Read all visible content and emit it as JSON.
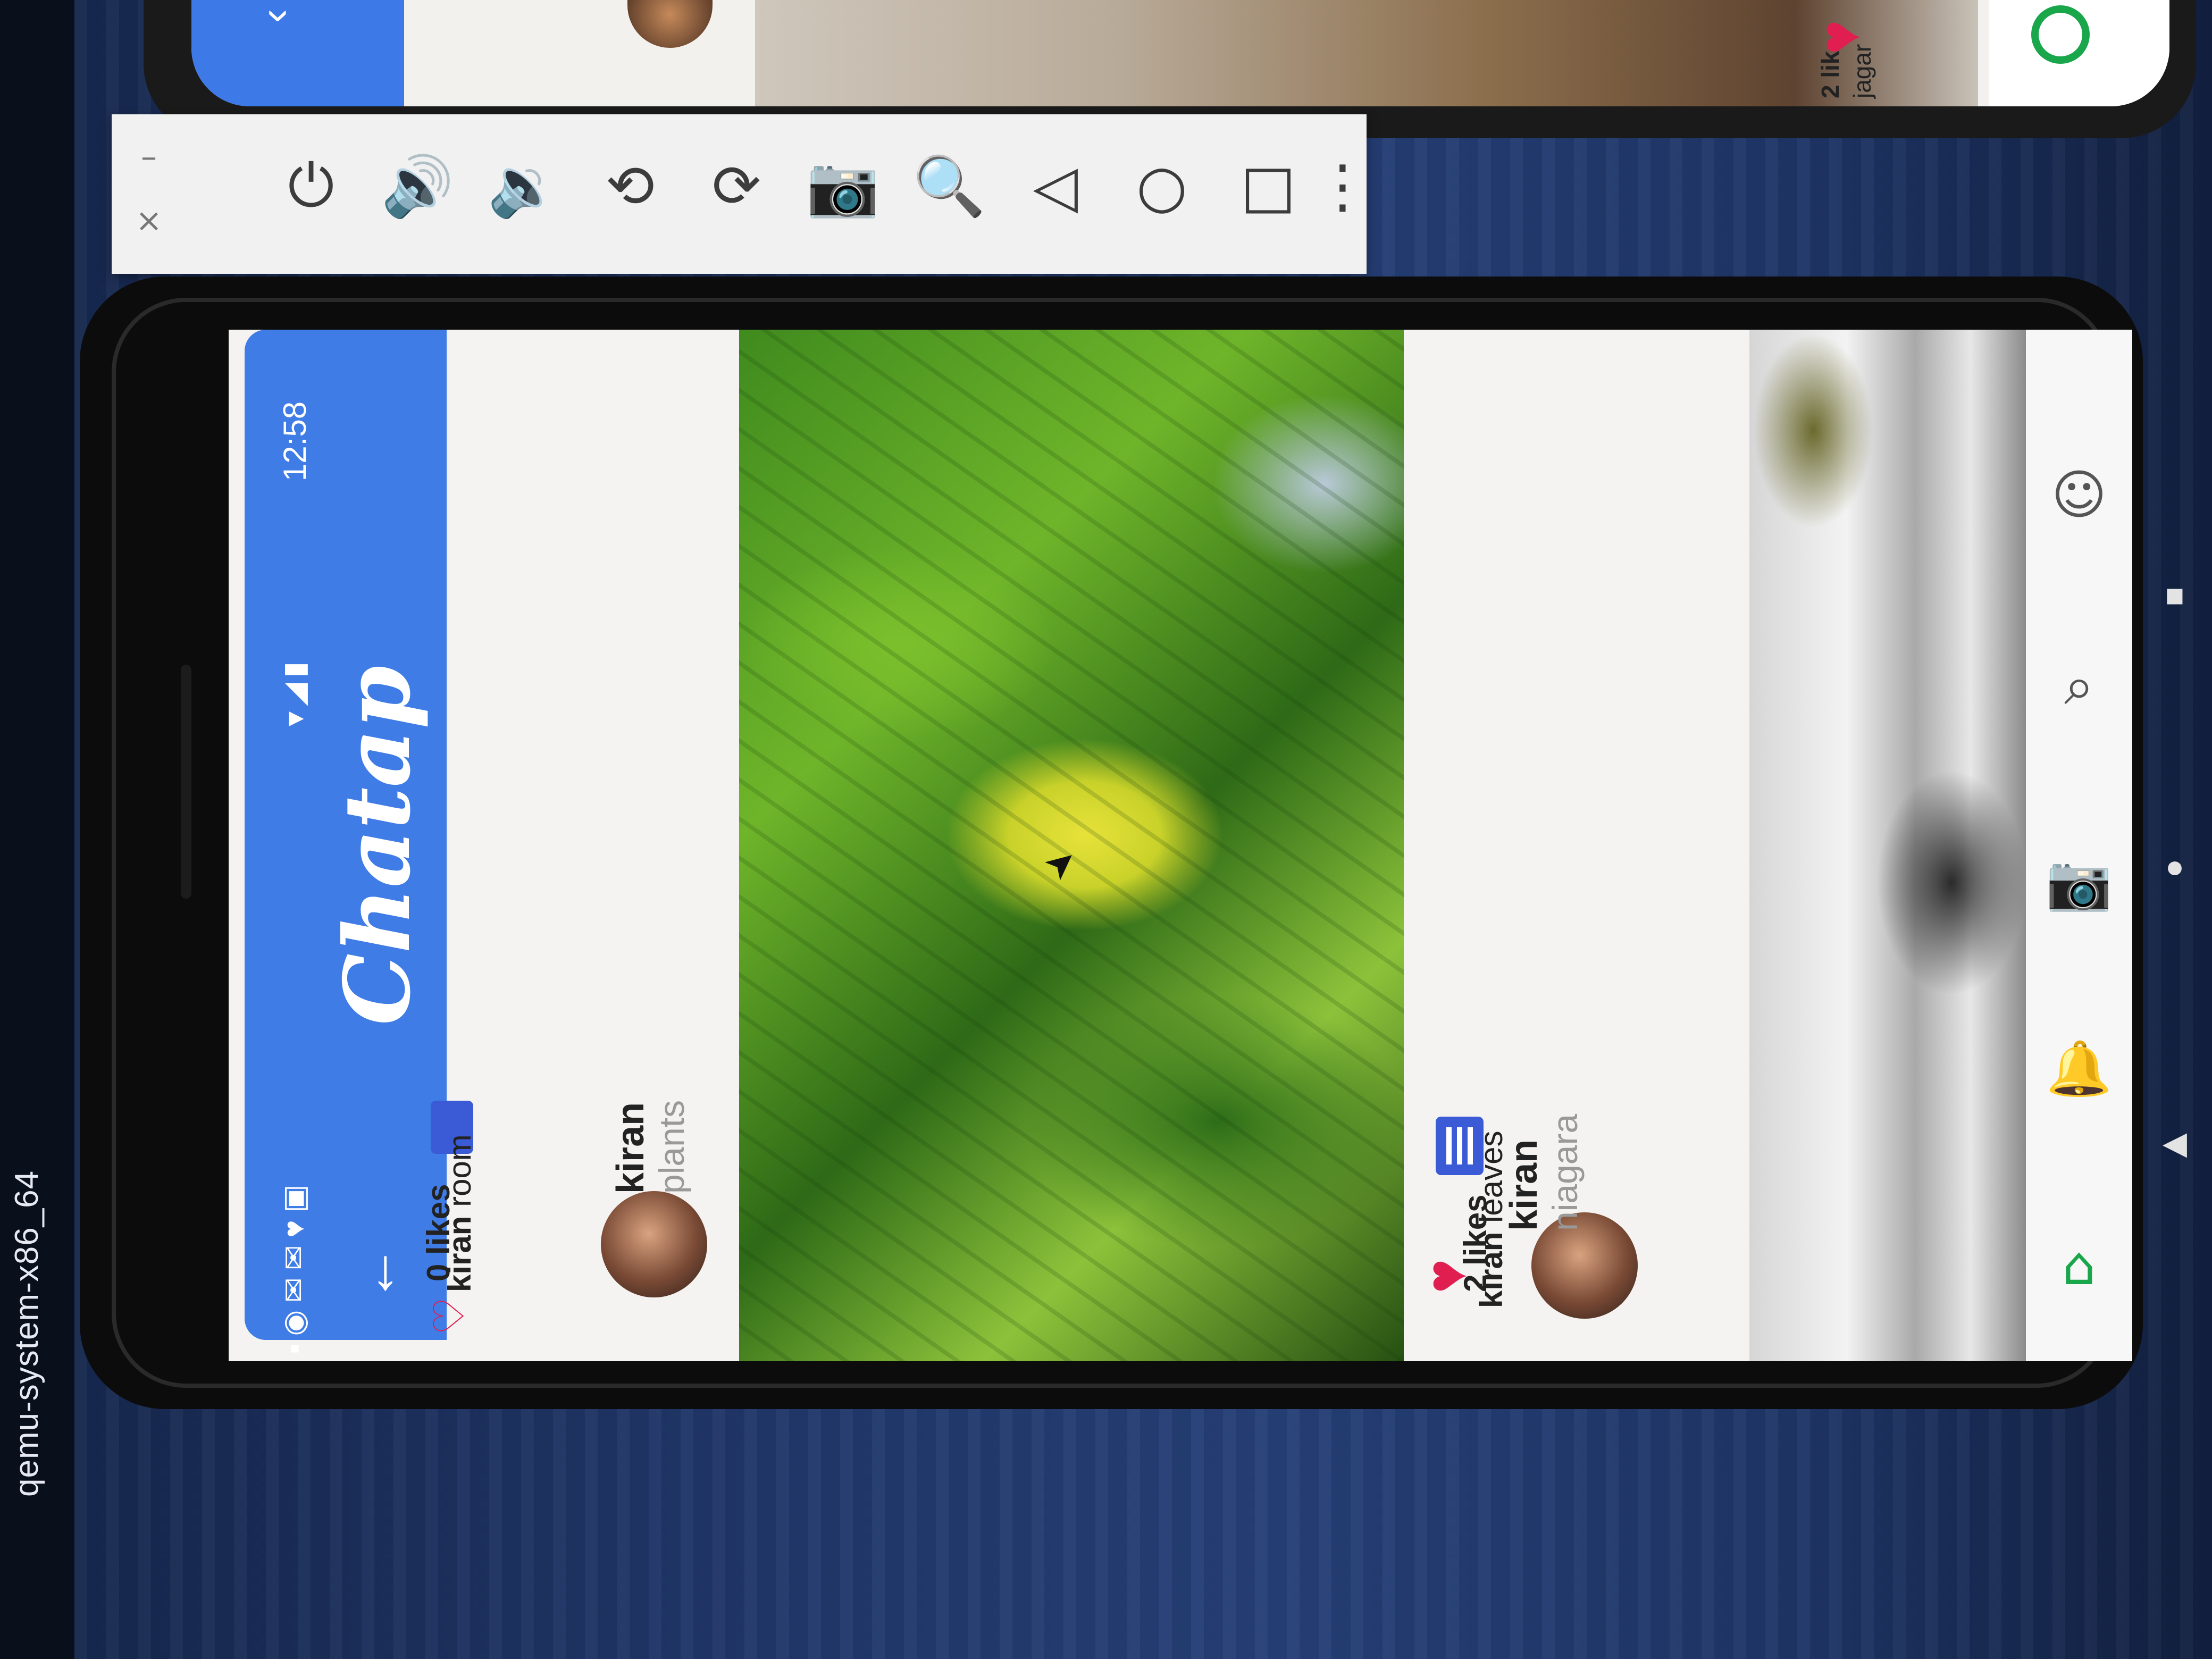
{
  "host_window": {
    "title": "qemu-system-x86_64"
  },
  "emulator_toolbar": {
    "buttons": [
      {
        "id": "close",
        "icon": "close-icon",
        "glyph": "×"
      },
      {
        "id": "minimize",
        "icon": "minimize-icon",
        "glyph": "–"
      },
      {
        "id": "power",
        "icon": "power-icon",
        "glyph": "⏻"
      },
      {
        "id": "volume-up",
        "icon": "volume-up-icon",
        "glyph": "🔊"
      },
      {
        "id": "volume-down",
        "icon": "volume-down-icon",
        "glyph": "🔉"
      },
      {
        "id": "rotate-left",
        "icon": "rotate-left-icon",
        "glyph": "⟲"
      },
      {
        "id": "rotate-right",
        "icon": "rotate-right-icon",
        "glyph": "⟳"
      },
      {
        "id": "screenshot",
        "icon": "camera-icon",
        "glyph": "📷"
      },
      {
        "id": "zoom",
        "icon": "zoom-icon",
        "glyph": "🔍"
      },
      {
        "id": "back",
        "icon": "back-triangle-icon",
        "glyph": "◁"
      },
      {
        "id": "home",
        "icon": "home-circle-icon",
        "glyph": "○"
      },
      {
        "id": "overview",
        "icon": "overview-square-icon",
        "glyph": "□"
      },
      {
        "id": "more",
        "icon": "more-icon",
        "glyph": "⋮"
      }
    ]
  },
  "status_bar": {
    "time": "12:58",
    "connectivity_icons": "▾◢▮",
    "notification_icons": "▪◉✉✉♥▣"
  },
  "app_bar": {
    "title": "Chatap",
    "back_icon": "←"
  },
  "posts": [
    {
      "username": "kiran",
      "caption_title": "plants",
      "likes": "0 likes",
      "caption_user": "kiran",
      "caption_text": "room",
      "liked": false,
      "heart_glyph": "♡"
    },
    {
      "username": "kiran",
      "caption_title": "niagara",
      "likes": "2 likes",
      "caption_user": "kiran",
      "caption_text": "leaves",
      "liked": true,
      "heart_glyph": "♥"
    }
  ],
  "bottom_nav": {
    "items": [
      {
        "icon": "home-icon",
        "glyph": "⌂"
      },
      {
        "icon": "notifications-icon",
        "glyph": "🔔"
      },
      {
        "icon": "camera-icon",
        "glyph": "📷"
      },
      {
        "icon": "search-icon",
        "glyph": "⌕"
      },
      {
        "icon": "profile-icon",
        "glyph": "☺"
      }
    ]
  },
  "second_phone": {
    "likes_text": "2 lik",
    "user_text": "jagar"
  },
  "colors": {
    "app_bar": "#3f7ce6",
    "heart": "#e01e50",
    "comment_icon": "#3b5bd6",
    "home_icon": "#1aa64b"
  }
}
